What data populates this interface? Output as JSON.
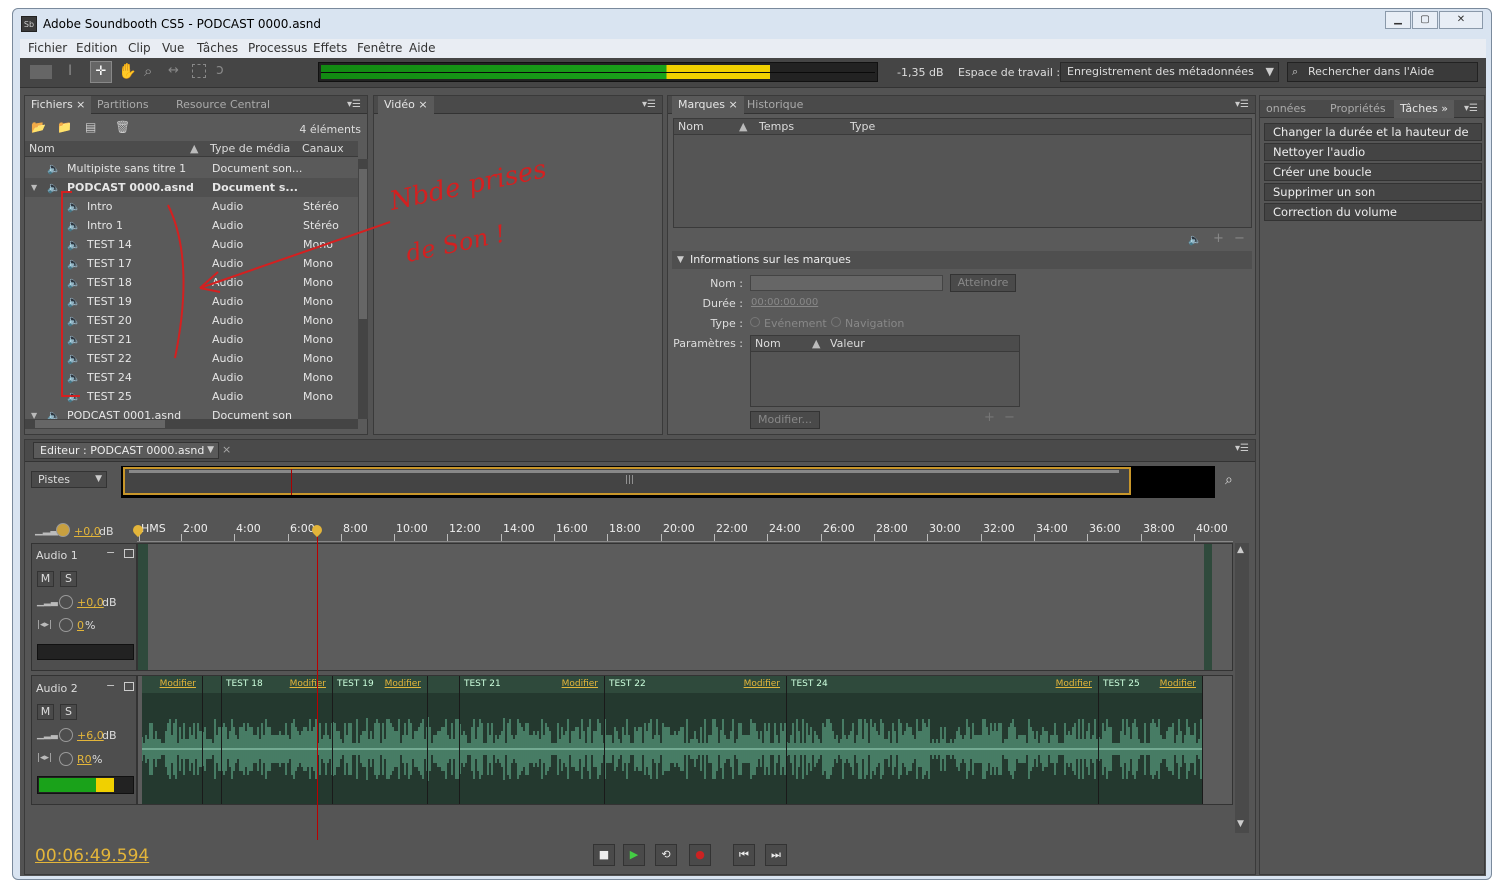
{
  "window": {
    "title": "Adobe Soundbooth CS5 - PODCAST 0000.asnd",
    "app_icon": "Sb"
  },
  "menu": [
    "Fichier",
    "Edition",
    "Clip",
    "Vue",
    "Tâches",
    "Processus",
    "Effets",
    "Fenêtre",
    "Aide"
  ],
  "toolbar": {
    "level_db": "-1,35 dB",
    "workspace_label": "Espace de travail :",
    "workspace_value": "Enregistrement des métadonnées",
    "search_placeholder": "Rechercher dans l'Aide",
    "meter_fraction": 0.805
  },
  "files_panel": {
    "tabs": [
      "Fichiers",
      "Partitions",
      "Resource Central"
    ],
    "count": "4 éléments",
    "columns": [
      "Nom",
      "Type de média",
      "Canaux"
    ],
    "rows": [
      {
        "name": "Multipiste sans titre 1",
        "type": "Document son...",
        "channels": ""
      },
      {
        "name": "PODCAST 0000.asnd",
        "type": "Document s...",
        "channels": ""
      },
      {
        "name": "Intro",
        "type": "Audio",
        "channels": "Stéréo"
      },
      {
        "name": "Intro 1",
        "type": "Audio",
        "channels": "Stéréo"
      },
      {
        "name": "TEST 14",
        "type": "Audio",
        "channels": "Mono"
      },
      {
        "name": "TEST 17",
        "type": "Audio",
        "channels": "Mono"
      },
      {
        "name": "TEST 18",
        "type": "Audio",
        "channels": "Mono"
      },
      {
        "name": "TEST 19",
        "type": "Audio",
        "channels": "Mono"
      },
      {
        "name": "TEST 20",
        "type": "Audio",
        "channels": "Mono"
      },
      {
        "name": "TEST 21",
        "type": "Audio",
        "channels": "Mono"
      },
      {
        "name": "TEST 22",
        "type": "Audio",
        "channels": "Mono"
      },
      {
        "name": "TEST 24",
        "type": "Audio",
        "channels": "Mono"
      },
      {
        "name": "TEST 25",
        "type": "Audio",
        "channels": "Mono"
      },
      {
        "name": "PODCAST 0001.asnd",
        "type": "Document son",
        "channels": ""
      }
    ]
  },
  "video_panel": {
    "tab": "Vidéo"
  },
  "markers_panel": {
    "tabs": [
      "Marques",
      "Historique"
    ],
    "columns": [
      "Nom",
      "Temps",
      "Type"
    ],
    "info_title": "Informations sur les marques",
    "labels": {
      "nom": "Nom :",
      "duree": "Durée :",
      "type": "Type :",
      "params": "Paramètres :"
    },
    "goto_button": "Atteindre",
    "duration_value": "00:00:00.000",
    "type_options": [
      "Evénement",
      "Navigation"
    ],
    "param_columns": [
      "Nom",
      "Valeur"
    ],
    "modify_button": "Modifier..."
  },
  "tasks_panel": {
    "tabs": [
      "onnées",
      "Propriétés",
      "Tâches"
    ],
    "items": [
      "Changer la durée et la hauteur de ton",
      "Nettoyer l'audio",
      "Créer une boucle",
      "Supprimer un son",
      "Correction du volume"
    ]
  },
  "editor": {
    "tab": "Editeur : PODCAST 0000.asnd",
    "tracks_dropdown": "Pistes",
    "master_gain": "+0,0",
    "db": "dB",
    "ruler": [
      "HMS",
      "2:00",
      "4:00",
      "6:00",
      "8:00",
      "10:00",
      "12:00",
      "14:00",
      "16:00",
      "18:00",
      "20:00",
      "22:00",
      "24:00",
      "26:00",
      "28:00",
      "30:00",
      "32:00",
      "34:00",
      "36:00",
      "38:00",
      "40:00"
    ],
    "tracks": [
      {
        "name": "Audio 1",
        "gain": "+0,0",
        "pan": "0",
        "pct": "%",
        "m": "M",
        "s": "S"
      },
      {
        "name": "Audio 2",
        "gain": "+6,0",
        "pan": "R0",
        "pct": "%",
        "m": "M",
        "s": "S"
      }
    ],
    "clips": [
      {
        "label": "",
        "modify": "Modifier"
      },
      {
        "label": "",
        "modify": ""
      },
      {
        "label": "TEST 18",
        "modify": "Modifier"
      },
      {
        "label": "TEST 19",
        "modify": "Modifier"
      },
      {
        "label": "",
        "modify": ""
      },
      {
        "label": "TEST 21",
        "modify": "Modifier"
      },
      {
        "label": "TEST 22",
        "modify": "Modifier"
      },
      {
        "label": "TEST 24",
        "modify": "Modifier"
      },
      {
        "label": "TEST 25",
        "modify": "Modifier"
      }
    ],
    "timecode": "00:06:49.594"
  },
  "annotation": {
    "text_line1": "Nbde prises",
    "text_line2": "de Son !",
    "color": "#d42020"
  }
}
